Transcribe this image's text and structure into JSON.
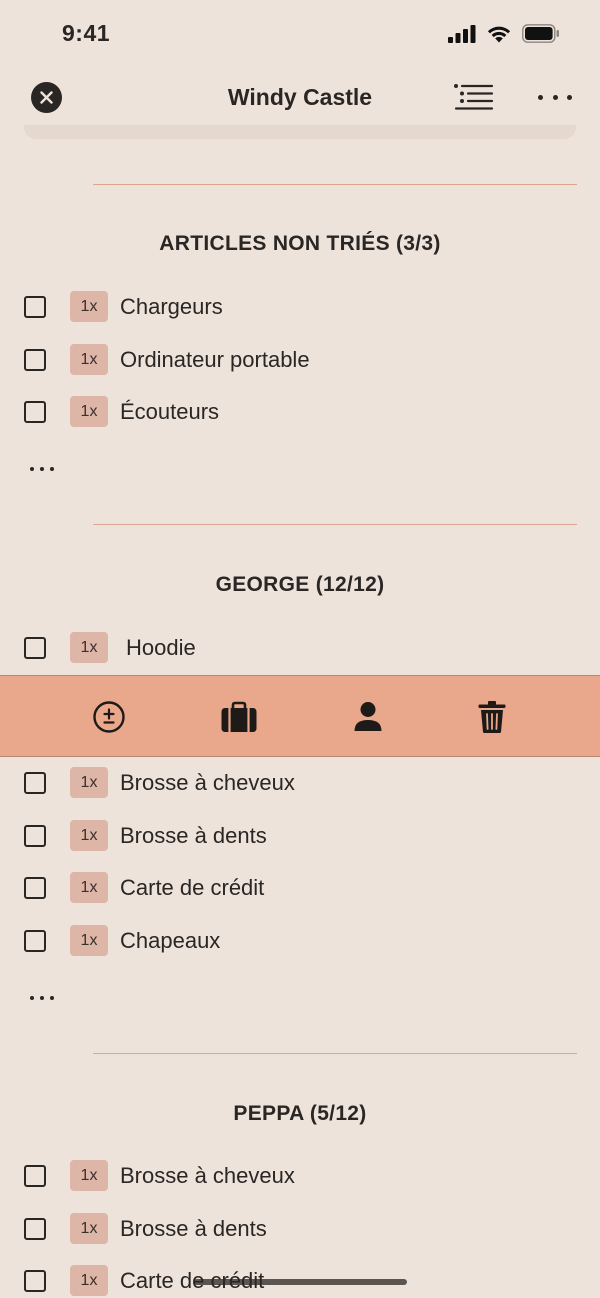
{
  "status_bar": {
    "time": "9:41"
  },
  "nav": {
    "title": "Windy Castle"
  },
  "sections": [
    {
      "title": "ARTICLES NON TRIÉS (3/3)",
      "items": [
        {
          "qty": "1x",
          "label": "Chargeurs"
        },
        {
          "qty": "1x",
          "label": "Ordinateur portable"
        },
        {
          "qty": "1x",
          "label": "Écouteurs"
        }
      ]
    },
    {
      "title": "GEORGE (12/12)",
      "items": [
        {
          "qty": "1x",
          "label": "Hoodie"
        },
        {
          "qty": "1x",
          "label": "Brosse à cheveux"
        },
        {
          "qty": "1x",
          "label": "Brosse à dents"
        },
        {
          "qty": "1x",
          "label": "Carte de crédit"
        },
        {
          "qty": "1x",
          "label": "Chapeaux"
        }
      ]
    },
    {
      "title": "PEPPA (5/12)",
      "items": [
        {
          "qty": "1x",
          "label": "Brosse à cheveux"
        },
        {
          "qty": "1x",
          "label": "Brosse à dents"
        },
        {
          "qty": "1x",
          "label": "Carte de crédit"
        }
      ]
    }
  ],
  "action_bar": {
    "icons": [
      "plus-minus-icon",
      "suitcase-icon",
      "person-icon",
      "trash-icon"
    ],
    "color": "#E9A88B"
  },
  "theme": {
    "background": "#EEE3DB",
    "qty_badge": "#DDB6A7",
    "divider": "#DDA78F"
  }
}
